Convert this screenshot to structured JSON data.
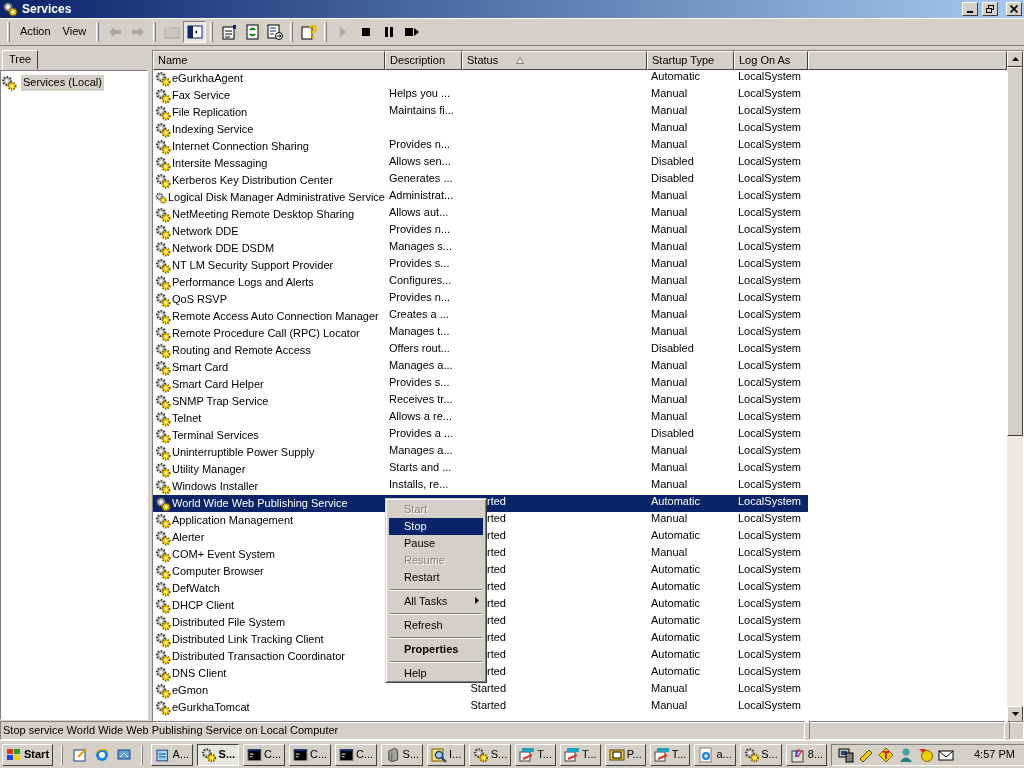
{
  "window": {
    "title": "Services"
  },
  "menu": [
    {
      "label": "Action"
    },
    {
      "label": "View"
    }
  ],
  "toolbar": [
    {
      "kind": "back",
      "disabled": true,
      "pressed": false
    },
    {
      "kind": "forward",
      "disabled": true,
      "pressed": false
    },
    {
      "kind": "up",
      "disabled": true,
      "pressed": false
    },
    {
      "kind": "tree",
      "disabled": false,
      "pressed": true
    },
    {
      "kind": "properties",
      "disabled": false,
      "pressed": false
    },
    {
      "kind": "refresh",
      "disabled": false,
      "pressed": false
    },
    {
      "kind": "export",
      "disabled": false,
      "pressed": false
    },
    {
      "kind": "help",
      "disabled": false,
      "pressed": false
    },
    {
      "kind": "play",
      "disabled": true,
      "pressed": false
    },
    {
      "kind": "stop",
      "disabled": false,
      "pressed": false
    },
    {
      "kind": "pause",
      "disabled": false,
      "pressed": false
    },
    {
      "kind": "restart",
      "disabled": false,
      "pressed": false
    }
  ],
  "tree": {
    "tabs": [
      {
        "label": "Tree",
        "selected": true
      }
    ],
    "items": [
      {
        "label": "Services (Local)",
        "selected": true
      }
    ]
  },
  "table": {
    "columns": [
      {
        "label": "Name",
        "sorted": false
      },
      {
        "label": "Description",
        "sorted": false
      },
      {
        "label": "Status",
        "sorted": true
      },
      {
        "label": "Startup Type",
        "sorted": false
      },
      {
        "label": "Log On As",
        "sorted": false
      }
    ],
    "rows": [
      {
        "name": "eGurkhaAgent",
        "description": "",
        "status": "",
        "startup": "Automatic",
        "logon": "LocalSystem",
        "selected": false
      },
      {
        "name": "Fax Service",
        "description": "Helps you ...",
        "status": "",
        "startup": "Manual",
        "logon": "LocalSystem",
        "selected": false
      },
      {
        "name": "File Replication",
        "description": "Maintains fi...",
        "status": "",
        "startup": "Manual",
        "logon": "LocalSystem",
        "selected": false
      },
      {
        "name": "Indexing Service",
        "description": "",
        "status": "",
        "startup": "Manual",
        "logon": "LocalSystem",
        "selected": false
      },
      {
        "name": "Internet Connection Sharing",
        "description": "Provides n...",
        "status": "",
        "startup": "Manual",
        "logon": "LocalSystem",
        "selected": false
      },
      {
        "name": "Intersite Messaging",
        "description": "Allows sen...",
        "status": "",
        "startup": "Disabled",
        "logon": "LocalSystem",
        "selected": false
      },
      {
        "name": "Kerberos Key Distribution Center",
        "description": "Generates ...",
        "status": "",
        "startup": "Disabled",
        "logon": "LocalSystem",
        "selected": false
      },
      {
        "name": "Logical Disk Manager Administrative Service",
        "description": "Administrat...",
        "status": "",
        "startup": "Manual",
        "logon": "LocalSystem",
        "selected": false
      },
      {
        "name": "NetMeeting Remote Desktop Sharing",
        "description": "Allows aut...",
        "status": "",
        "startup": "Manual",
        "logon": "LocalSystem",
        "selected": false
      },
      {
        "name": "Network DDE",
        "description": "Provides n...",
        "status": "",
        "startup": "Manual",
        "logon": "LocalSystem",
        "selected": false
      },
      {
        "name": "Network DDE DSDM",
        "description": "Manages s...",
        "status": "",
        "startup": "Manual",
        "logon": "LocalSystem",
        "selected": false
      },
      {
        "name": "NT LM Security Support Provider",
        "description": "Provides s...",
        "status": "",
        "startup": "Manual",
        "logon": "LocalSystem",
        "selected": false
      },
      {
        "name": "Performance Logs and Alerts",
        "description": "Configures...",
        "status": "",
        "startup": "Manual",
        "logon": "LocalSystem",
        "selected": false
      },
      {
        "name": "QoS RSVP",
        "description": "Provides n...",
        "status": "",
        "startup": "Manual",
        "logon": "LocalSystem",
        "selected": false
      },
      {
        "name": "Remote Access Auto Connection Manager",
        "description": "Creates a ...",
        "status": "",
        "startup": "Manual",
        "logon": "LocalSystem",
        "selected": false
      },
      {
        "name": "Remote Procedure Call (RPC) Locator",
        "description": "Manages t...",
        "status": "",
        "startup": "Manual",
        "logon": "LocalSystem",
        "selected": false
      },
      {
        "name": "Routing and Remote Access",
        "description": "Offers rout...",
        "status": "",
        "startup": "Disabled",
        "logon": "LocalSystem",
        "selected": false
      },
      {
        "name": "Smart Card",
        "description": "Manages a...",
        "status": "",
        "startup": "Manual",
        "logon": "LocalSystem",
        "selected": false
      },
      {
        "name": "Smart Card Helper",
        "description": "Provides s...",
        "status": "",
        "startup": "Manual",
        "logon": "LocalSystem",
        "selected": false
      },
      {
        "name": "SNMP Trap Service",
        "description": "Receives tr...",
        "status": "",
        "startup": "Manual",
        "logon": "LocalSystem",
        "selected": false
      },
      {
        "name": "Telnet",
        "description": "Allows a re...",
        "status": "",
        "startup": "Manual",
        "logon": "LocalSystem",
        "selected": false
      },
      {
        "name": "Terminal Services",
        "description": "Provides a ...",
        "status": "",
        "startup": "Disabled",
        "logon": "LocalSystem",
        "selected": false
      },
      {
        "name": "Uninterruptible Power Supply",
        "description": "Manages a...",
        "status": "",
        "startup": "Manual",
        "logon": "LocalSystem",
        "selected": false
      },
      {
        "name": "Utility Manager",
        "description": "Starts and ...",
        "status": "",
        "startup": "Manual",
        "logon": "LocalSystem",
        "selected": false
      },
      {
        "name": "Windows Installer",
        "description": "Installs, re...",
        "status": "",
        "startup": "Manual",
        "logon": "LocalSystem",
        "selected": false
      },
      {
        "name": "World Wide Web Publishing Service",
        "description": "",
        "status": "rted",
        "startup": "Automatic",
        "logon": "LocalSystem",
        "selected": true
      },
      {
        "name": "Application Management",
        "description": "",
        "status": "rted",
        "startup": "Manual",
        "logon": "LocalSystem",
        "selected": false
      },
      {
        "name": "Alerter",
        "description": "",
        "status": "rted",
        "startup": "Automatic",
        "logon": "LocalSystem",
        "selected": false
      },
      {
        "name": "COM+ Event System",
        "description": "",
        "status": "rted",
        "startup": "Manual",
        "logon": "LocalSystem",
        "selected": false
      },
      {
        "name": "Computer Browser",
        "description": "",
        "status": "rted",
        "startup": "Automatic",
        "logon": "LocalSystem",
        "selected": false
      },
      {
        "name": "DefWatch",
        "description": "",
        "status": "rted",
        "startup": "Automatic",
        "logon": "LocalSystem",
        "selected": false
      },
      {
        "name": "DHCP Client",
        "description": "",
        "status": "rted",
        "startup": "Automatic",
        "logon": "LocalSystem",
        "selected": false
      },
      {
        "name": "Distributed File System",
        "description": "",
        "status": "rted",
        "startup": "Automatic",
        "logon": "LocalSystem",
        "selected": false
      },
      {
        "name": "Distributed Link Tracking Client",
        "description": "",
        "status": "rted",
        "startup": "Automatic",
        "logon": "LocalSystem",
        "selected": false
      },
      {
        "name": "Distributed Transaction Coordinator",
        "description": "",
        "status": "rted",
        "startup": "Automatic",
        "logon": "LocalSystem",
        "selected": false
      },
      {
        "name": "DNS Client",
        "description": "",
        "status": "rted",
        "startup": "Automatic",
        "logon": "LocalSystem",
        "selected": false
      },
      {
        "name": "eGmon",
        "description": "",
        "status": "Started",
        "startup": "Manual",
        "logon": "LocalSystem",
        "selected": false
      },
      {
        "name": "eGurkhaTomcat",
        "description": "",
        "status": "Started",
        "startup": "Manual",
        "logon": "LocalSystem",
        "selected": false
      }
    ]
  },
  "context_menu": {
    "items": [
      {
        "kind": "item",
        "label": "Start",
        "disabled": true,
        "selected": false,
        "default": false,
        "submenu": false
      },
      {
        "kind": "item",
        "label": "Stop",
        "disabled": false,
        "selected": true,
        "default": false,
        "submenu": false
      },
      {
        "kind": "item",
        "label": "Pause",
        "disabled": false,
        "selected": false,
        "default": false,
        "submenu": false
      },
      {
        "kind": "item",
        "label": "Resume",
        "disabled": true,
        "selected": false,
        "default": false,
        "submenu": false
      },
      {
        "kind": "item",
        "label": "Restart",
        "disabled": false,
        "selected": false,
        "default": false,
        "submenu": false
      },
      {
        "kind": "separator"
      },
      {
        "kind": "item",
        "label": "All Tasks",
        "disabled": false,
        "selected": false,
        "default": false,
        "submenu": true
      },
      {
        "kind": "separator"
      },
      {
        "kind": "item",
        "label": "Refresh",
        "disabled": false,
        "selected": false,
        "default": false,
        "submenu": false
      },
      {
        "kind": "separator"
      },
      {
        "kind": "item",
        "label": "Properties",
        "disabled": false,
        "selected": false,
        "default": true,
        "submenu": false
      },
      {
        "kind": "separator"
      },
      {
        "kind": "item",
        "label": "Help",
        "disabled": false,
        "selected": false,
        "default": false,
        "submenu": false
      }
    ]
  },
  "status_bar": {
    "text": "Stop service World Wide Web Publishing Service on Local Computer"
  },
  "taskbar": {
    "start": "Start",
    "tasks": [
      {
        "kind": "notepad",
        "label": "A...",
        "selected": false
      },
      {
        "kind": "gears",
        "label": "S...",
        "selected": true
      },
      {
        "kind": "console",
        "label": "C...",
        "selected": false
      },
      {
        "kind": "console",
        "label": "C...",
        "selected": false
      },
      {
        "kind": "console",
        "label": "C...",
        "selected": false
      },
      {
        "kind": "server",
        "label": "S...",
        "selected": false
      },
      {
        "kind": "magnifier",
        "label": "I...",
        "selected": false
      },
      {
        "kind": "gears",
        "label": "S...",
        "selected": false
      },
      {
        "kind": "terminal",
        "label": "T...",
        "selected": false
      },
      {
        "kind": "terminal",
        "label": "T...",
        "selected": false
      },
      {
        "kind": "device",
        "label": "P...",
        "selected": false
      },
      {
        "kind": "terminal",
        "label": "T...",
        "selected": false
      },
      {
        "kind": "browser",
        "label": "a...",
        "selected": false
      },
      {
        "kind": "gears",
        "label": "S...",
        "selected": false
      },
      {
        "kind": "paint",
        "label": "8...",
        "selected": false
      }
    ],
    "clock": "4:57 PM"
  }
}
